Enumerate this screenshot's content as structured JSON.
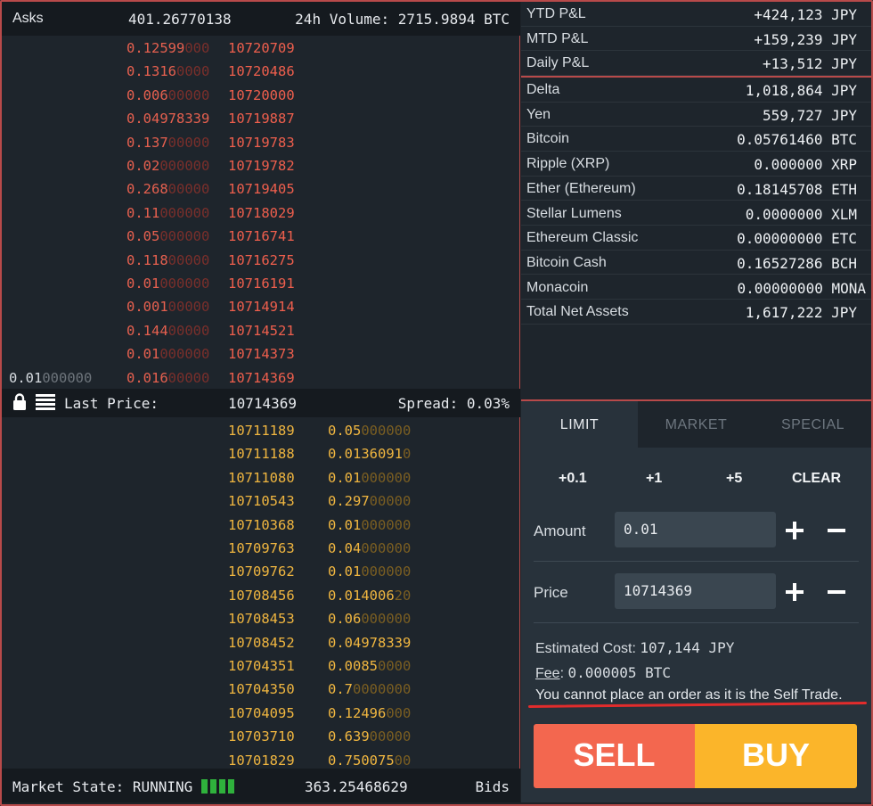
{
  "book": {
    "header": {
      "label": "Asks",
      "total": "401.26770138",
      "volume": "24h Volume: 2715.9894 BTC"
    },
    "asks": [
      {
        "qty_hi": "0.12599",
        "qty_lo": "000",
        "price": "10720709"
      },
      {
        "qty_hi": "0.1316",
        "qty_lo": "0000",
        "price": "10720486"
      },
      {
        "qty_hi": "0.006",
        "qty_lo": "00000",
        "price": "10720000"
      },
      {
        "qty_hi": "0.04978339",
        "qty_lo": "",
        "price": "10719887"
      },
      {
        "qty_hi": "0.137",
        "qty_lo": "00000",
        "price": "10719783"
      },
      {
        "qty_hi": "0.02",
        "qty_lo": "000000",
        "price": "10719782"
      },
      {
        "qty_hi": "0.268",
        "qty_lo": "00000",
        "price": "10719405"
      },
      {
        "qty_hi": "0.11",
        "qty_lo": "000000",
        "price": "10718029"
      },
      {
        "qty_hi": "0.05",
        "qty_lo": "000000",
        "price": "10716741"
      },
      {
        "qty_hi": "0.118",
        "qty_lo": "00000",
        "price": "10716275"
      },
      {
        "qty_hi": "0.01",
        "qty_lo": "000000",
        "price": "10716191"
      },
      {
        "qty_hi": "0.001",
        "qty_lo": "00000",
        "price": "10714914"
      },
      {
        "qty_hi": "0.144",
        "qty_lo": "00000",
        "price": "10714521"
      },
      {
        "qty_hi": "0.01",
        "qty_lo": "000000",
        "price": "10714373"
      },
      {
        "qty_hi": "0.016",
        "qty_lo": "00000",
        "price": "10714369",
        "own_hi": "0.01",
        "own_lo": "000000"
      }
    ],
    "last": {
      "label": "Last Price:",
      "value": "10714369",
      "spread": "Spread:  0.03%"
    },
    "bids": [
      {
        "price": "10711189",
        "qty_hi": "0.05",
        "qty_lo": "000000"
      },
      {
        "price": "10711188",
        "qty_hi": "0.0136091",
        "qty_lo": "0"
      },
      {
        "price": "10711080",
        "qty_hi": "0.01",
        "qty_lo": "000000"
      },
      {
        "price": "10710543",
        "qty_hi": "0.297",
        "qty_lo": "00000"
      },
      {
        "price": "10710368",
        "qty_hi": "0.01",
        "qty_lo": "000000"
      },
      {
        "price": "10709763",
        "qty_hi": "0.04",
        "qty_lo": "000000"
      },
      {
        "price": "10709762",
        "qty_hi": "0.01",
        "qty_lo": "000000"
      },
      {
        "price": "10708456",
        "qty_hi": "0.014006",
        "qty_lo": "20"
      },
      {
        "price": "10708453",
        "qty_hi": "0.06",
        "qty_lo": "000000"
      },
      {
        "price": "10708452",
        "qty_hi": "0.04978339",
        "qty_lo": ""
      },
      {
        "price": "10704351",
        "qty_hi": "0.0085",
        "qty_lo": "0000"
      },
      {
        "price": "10704350",
        "qty_hi": "0.7",
        "qty_lo": "0000000"
      },
      {
        "price": "10704095",
        "qty_hi": "0.12496",
        "qty_lo": "000"
      },
      {
        "price": "10703710",
        "qty_hi": "0.639",
        "qty_lo": "00000"
      },
      {
        "price": "10701829",
        "qty_hi": "0.750075",
        "qty_lo": "00"
      }
    ],
    "footer": {
      "state": "Market State: RUNNING",
      "total": "363.25468629",
      "label": "Bids"
    }
  },
  "pl": [
    {
      "name": "YTD P&L",
      "value": "+424,123 JPY"
    },
    {
      "name": "MTD P&L",
      "value": "+159,239 JPY"
    },
    {
      "name": "Daily P&L",
      "value": "+13,512 JPY"
    }
  ],
  "balances": [
    {
      "name": "Delta",
      "value": "1,018,864 JPY"
    },
    {
      "name": "Yen",
      "value": "559,727 JPY"
    },
    {
      "name": "Bitcoin",
      "value": "0.05761460 BTC"
    },
    {
      "name": "Ripple (XRP)",
      "value": "0.000000 XRP"
    },
    {
      "name": "Ether (Ethereum)",
      "value": "0.18145708 ETH"
    },
    {
      "name": "Stellar Lumens",
      "value": "0.0000000 XLM"
    },
    {
      "name": "Ethereum Classic",
      "value": "0.00000000 ETC"
    },
    {
      "name": "Bitcoin Cash",
      "value": "0.16527286 BCH"
    },
    {
      "name": "Monacoin",
      "value": "0.00000000 MONA"
    },
    {
      "name": "Total Net Assets",
      "value": "1,617,222 JPY"
    }
  ],
  "order": {
    "tabs": [
      "LIMIT",
      "MARKET",
      "SPECIAL"
    ],
    "steps": [
      "+0.1",
      "+1",
      "+5",
      "CLEAR"
    ],
    "amount_label": "Amount",
    "amount_value": "0.01",
    "price_label": "Price",
    "price_value": "10714369",
    "est_label": "Estimated Cost:",
    "est_value": "107,144 JPY",
    "fee_label": "Fee",
    "fee_value": "0.000005 BTC",
    "warning": "You cannot place an order as it is the Self Trade.",
    "sell": "SELL",
    "buy": "BUY"
  },
  "colors": {
    "ask": "#ef5f4d",
    "bid": "#f0b640",
    "sell": "#f3674f",
    "buy": "#fbb52a",
    "running": "#2fb13c",
    "alert": "#e22c2c"
  }
}
